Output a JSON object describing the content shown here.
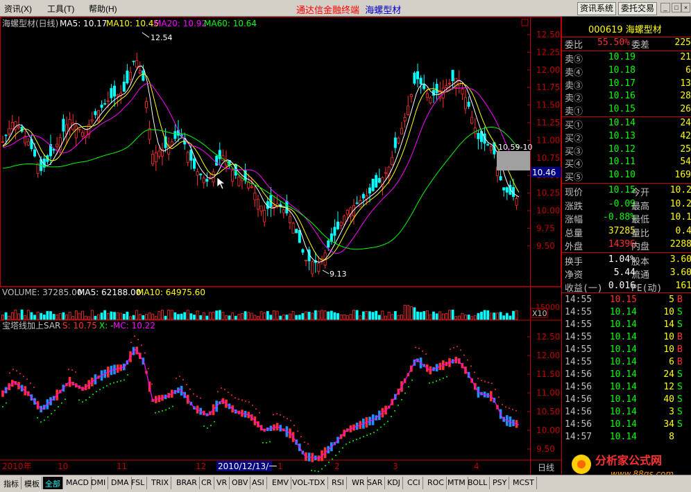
{
  "menu": {
    "items": [
      "资讯(X)",
      "工具(T)",
      "帮助(H)"
    ]
  },
  "app_title": "通达信金融终端",
  "stock_title": "海螺型材",
  "top_buttons": [
    "资讯系统",
    "委托交易"
  ],
  "main_chart": {
    "header": {
      "name": "海螺型材(日线)",
      "ma5": "MA5: 10.17",
      "ma10": "MA10: 10.45",
      "ma20": "MA20: 10.92",
      "ma60": "MA60: 10.64"
    },
    "y_ticks": [
      "12.50",
      "12.25",
      "12.00",
      "11.75",
      "11.50",
      "11.25",
      "11.00",
      "10.75",
      "10.50",
      "10.25",
      "10.00",
      "9.75",
      "9.50"
    ],
    "high_label": "12.54",
    "low_label": "9.13",
    "mark_label": "10.59-10",
    "price_tag": "10.46"
  },
  "volume_chart": {
    "header": {
      "vol": "VOLUME: 37285.00",
      "ma5": "MA5: 62188.00",
      "ma10": "MA10: 64975.60"
    },
    "tick": "15000",
    "unit": "X10"
  },
  "sar_chart": {
    "header": {
      "name": "宝塔线加上SAR",
      "s": "S: 10.75",
      "x": "X: -",
      "mc": "MC: 10.22"
    },
    "y_ticks": [
      "12.50",
      "12.00",
      "11.50",
      "11.00",
      "10.50",
      "10.00",
      "9.50"
    ]
  },
  "date_axis": {
    "year": "2010年",
    "months": [
      "10",
      "11",
      "12",
      "1",
      "2",
      "3",
      "4"
    ],
    "cursor_date": "2010/12/13/一",
    "period": "日线"
  },
  "quote": {
    "code": "000619",
    "name": "海螺型材",
    "weibi_label": "委比",
    "weibi_value": "55.50%",
    "weicha_label": "委差",
    "weicha_value": "225",
    "sell": [
      {
        "label": "卖⑤",
        "price": "10.19",
        "vol": "21"
      },
      {
        "label": "卖④",
        "price": "10.18",
        "vol": "6"
      },
      {
        "label": "卖③",
        "price": "10.17",
        "vol": "13"
      },
      {
        "label": "卖②",
        "price": "10.16",
        "vol": "28"
      },
      {
        "label": "卖①",
        "price": "10.15",
        "vol": "26"
      }
    ],
    "buy": [
      {
        "label": "买①",
        "price": "10.14",
        "vol": "24"
      },
      {
        "label": "买②",
        "price": "10.13",
        "vol": "42"
      },
      {
        "label": "买③",
        "price": "10.12",
        "vol": "25"
      },
      {
        "label": "买④",
        "price": "10.11",
        "vol": "54"
      },
      {
        "label": "买⑤",
        "price": "10.10",
        "vol": "169"
      }
    ],
    "stats": [
      {
        "l1": "现价",
        "v1": "10.15",
        "l2": "今开",
        "v2": "10.2"
      },
      {
        "l1": "涨跌",
        "v1": "-0.09",
        "l2": "最高",
        "v2": "10.2"
      },
      {
        "l1": "涨幅",
        "v1": "-0.88%",
        "l2": "最低",
        "v2": "10.1"
      },
      {
        "l1": "总量",
        "v1": "37285",
        "l2": "量比",
        "v2": "0.4"
      },
      {
        "l1": "外盘",
        "v1": "14396",
        "l2": "内盘",
        "v2": "2288"
      }
    ],
    "stats2": [
      {
        "l1": "换手",
        "v1": "1.04%",
        "l2": "股本",
        "v2": "3.60"
      },
      {
        "l1": "净资",
        "v1": "5.44",
        "l2": "流通",
        "v2": "3.60"
      },
      {
        "l1": "收益(一)",
        "v1": "0.016",
        "l2": "PE(动)",
        "v2": "161"
      }
    ],
    "ticks": [
      {
        "t": "14:55",
        "p": "10.15",
        "v": "5",
        "d": "B"
      },
      {
        "t": "14:55",
        "p": "10.14",
        "v": "10",
        "d": "S"
      },
      {
        "t": "14:55",
        "p": "10.14",
        "v": "14",
        "d": "S"
      },
      {
        "t": "14:55",
        "p": "10.14",
        "v": "10",
        "d": "B"
      },
      {
        "t": "14:55",
        "p": "10.14",
        "v": "10",
        "d": "B"
      },
      {
        "t": "14:55",
        "p": "10.14",
        "v": "6",
        "d": "B"
      },
      {
        "t": "14:56",
        "p": "10.14",
        "v": "24",
        "d": "S"
      },
      {
        "t": "14:56",
        "p": "10.14",
        "v": "12",
        "d": "S"
      },
      {
        "t": "14:56",
        "p": "10.14",
        "v": "40",
        "d": "S"
      },
      {
        "t": "14:56",
        "p": "10.14",
        "v": "3",
        "d": "S"
      },
      {
        "t": "14:56",
        "p": "10.14",
        "v": "34",
        "d": "S"
      },
      {
        "t": "14:57",
        "p": "10.14",
        "v": "8",
        "d": ""
      }
    ]
  },
  "tabs": [
    "指标",
    "模板",
    "全部",
    "MACD",
    "DMI",
    "DMA",
    "FSL",
    "TRIX",
    "BRAR",
    "CR",
    "VR",
    "OBV",
    "ASI",
    "EMV",
    "VOL-TDX",
    "RSI",
    "WR",
    "SAR",
    "KDJ",
    "CCI",
    "ROC",
    "MTM",
    "BOLL",
    "PSY",
    "MCST"
  ],
  "logo": {
    "text": "分析家公式网",
    "url": "www.88gs.com"
  },
  "colors": {
    "up": "#ff3030",
    "down": "#00ffff",
    "ma5": "#ffffff",
    "ma10": "#ffff00",
    "ma20": "#ff00ff",
    "ma60": "#00ff00",
    "grid": "#c00000"
  }
}
